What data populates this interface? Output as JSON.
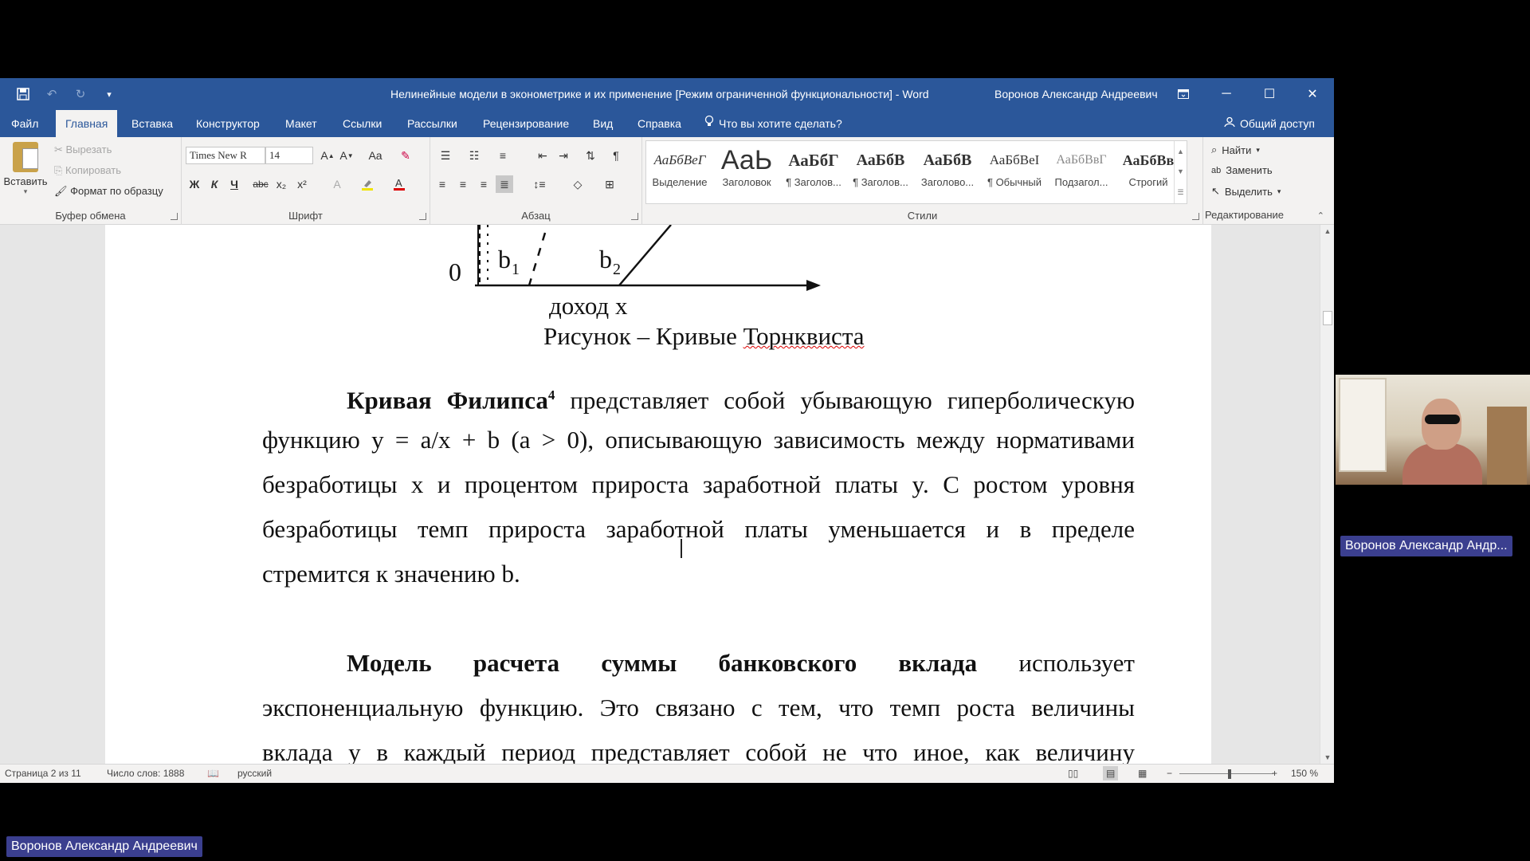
{
  "window": {
    "title": "Нелинейные модели в эконометрике и их применение [Режим ограниченной функциональности]  -  Word",
    "user": "Воронов Александр Андреевич"
  },
  "tabs": [
    "Файл",
    "Главная",
    "Вставка",
    "Конструктор",
    "Макет",
    "Ссылки",
    "Рассылки",
    "Рецензирование",
    "Вид",
    "Справка"
  ],
  "active_tab": "Главная",
  "tell_me": "Что вы хотите сделать?",
  "share": "Общий доступ",
  "ribbon": {
    "clipboard": {
      "paste": "Вставить",
      "cut": "Вырезать",
      "copy": "Копировать",
      "format_painter": "Формат по образцу",
      "label": "Буфер обмена"
    },
    "font": {
      "name": "Times New R",
      "size": "14",
      "label": "Шрифт",
      "bold": "Ж",
      "italic": "К",
      "underline": "Ч",
      "strike": "abc",
      "sub": "x₂",
      "sup": "x²",
      "case": "Aa"
    },
    "paragraph": {
      "label": "Абзац"
    },
    "styles": {
      "label": "Стили",
      "items": [
        {
          "preview": "АаБбВеГ",
          "name": "Выделение"
        },
        {
          "preview": "АаЬ",
          "name": "Заголовок"
        },
        {
          "preview": "АаБбГ",
          "name": "¶ Заголов..."
        },
        {
          "preview": "АаБбВ",
          "name": "¶ Заголов..."
        },
        {
          "preview": "АаБбВ",
          "name": "Заголово..."
        },
        {
          "preview": "АаБбВеI",
          "name": "¶ Обычный"
        },
        {
          "preview": "АаБбВвГ",
          "name": "Подзагол..."
        },
        {
          "preview": "АаБбВв",
          "name": "Строгий"
        }
      ]
    },
    "editing": {
      "find": "Найти",
      "replace": "Заменить",
      "select": "Выделить",
      "label": "Редактирование"
    }
  },
  "figure": {
    "origin": "0",
    "b1": "b",
    "b1_sub": "1",
    "b2": "b",
    "b2_sub": "2",
    "x_label": "доход x",
    "caption_prefix": "Рисунок – Кривые ",
    "caption_misspelled": "Торнквиста"
  },
  "document": {
    "para1": {
      "bold": "Кривая Филипса",
      "footnote": "4",
      "line1_rest": " представляет собой убывающую гиперболическую",
      "line2": "функцию y = a/x  + b (a > 0), описывающую зависимость между нормативами",
      "line3": "безработицы x и процентом прироста заработной платы y. С ростом уровня",
      "line4": "безработицы темп прироста заработной платы уменьшается и в пределе",
      "line5": "стремится к значению b."
    },
    "para2": {
      "bold": "Модель расчета суммы банковского вклада",
      "line1_rest": " использует",
      "line2": "экспоненциальную функцию. Это связано с тем, что темп роста величины",
      "line3": "вклада y в каждый период представляет собой не что иное, как величину"
    }
  },
  "status": {
    "page": "Страница 2 из 11",
    "words": "Число слов: 1888",
    "language": "русский",
    "zoom": "150 %"
  },
  "participant": {
    "cam_name": "Воронов Александр Андр...",
    "bottom_name": "Воронов Александр Андреевич"
  }
}
